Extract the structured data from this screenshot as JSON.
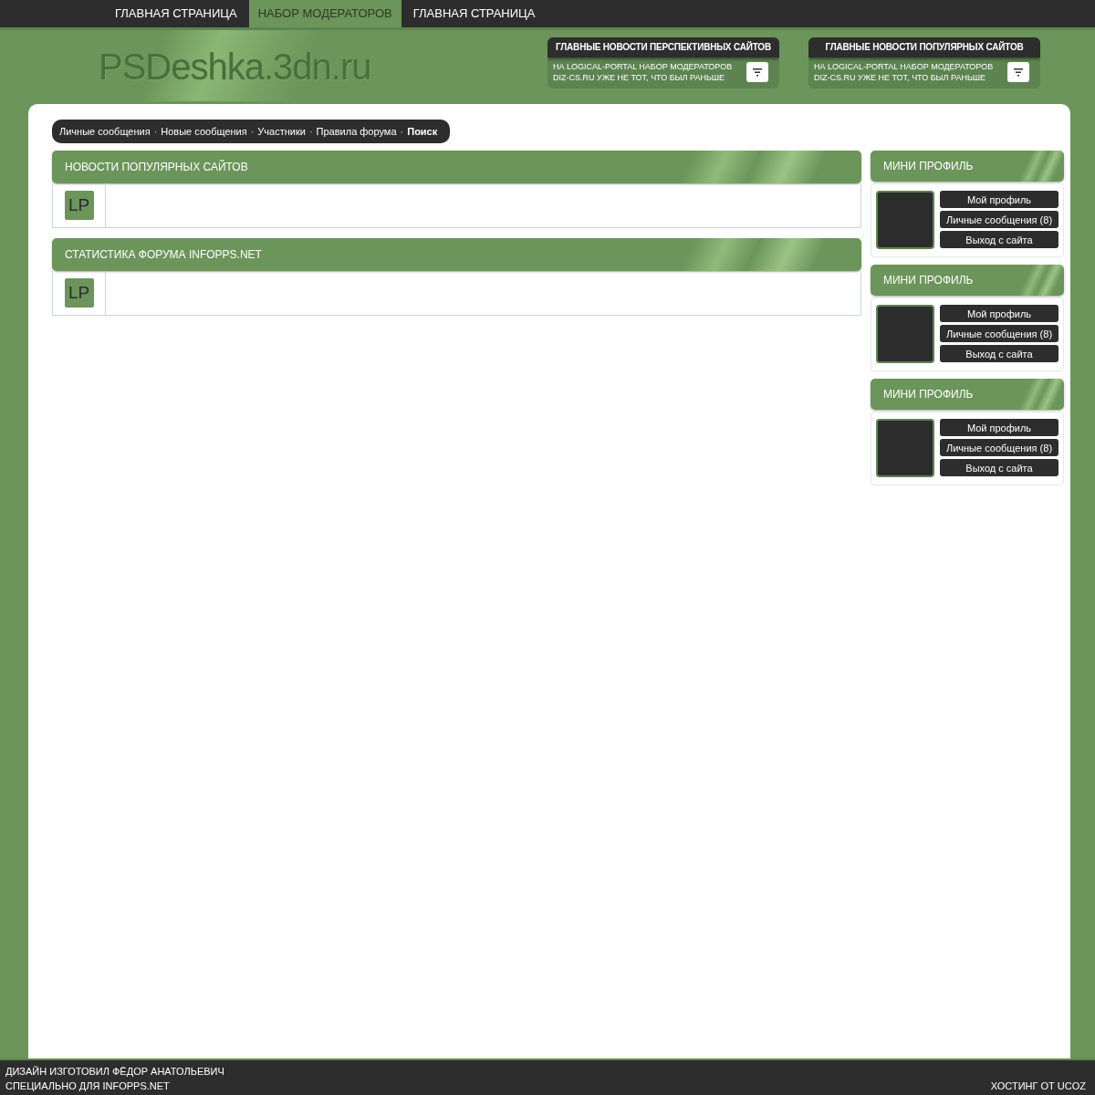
{
  "nav": [
    {
      "label": "ГЛАВНАЯ СТРАНИЦА",
      "selected": false
    },
    {
      "label": "НАБОР МОДЕРАТОРОВ",
      "selected": true
    },
    {
      "label": "ГЛАВНАЯ СТРАНИЦА",
      "selected": false
    }
  ],
  "logo": "PSDeshka.3dn.ru",
  "news_boxes": [
    {
      "title": "ГЛАВНЫЕ НОВОСТИ ПЕРСПЕКТИВНЫХ САЙТОВ",
      "lines": [
        "НА LOGICAL-PORTAL НАБОР МОДЕРАТОРОВ",
        "DIZ-CS.RU УЖЕ НЕ ТОТ, ЧТО БЫЛ РАНЬШЕ"
      ]
    },
    {
      "title": "ГЛАВНЫЕ НОВОСТИ ПОПУЛЯРНЫХ САЙТОВ",
      "lines": [
        "НА LOGICAL-PORTAL НАБОР МОДЕРАТОРОВ",
        "DIZ-CS.RU УЖЕ НЕ ТОТ, ЧТО БЫЛ РАНЬШЕ"
      ]
    }
  ],
  "breadcrumb": {
    "separator": "·",
    "links": [
      {
        "label": "Личные сообщения",
        "bold": false
      },
      {
        "label": "Новые сообщения",
        "bold": false
      },
      {
        "label": "Участники",
        "bold": false
      },
      {
        "label": "Правила форума",
        "bold": false
      },
      {
        "label": "Поиск",
        "bold": true
      }
    ]
  },
  "forum_blocks": [
    {
      "title": "НОВОСТИ ПОПУЛЯРНЫХ САЙТОВ",
      "badge": "LP"
    },
    {
      "title": "СТАТИСТИКА ФОРУМА INFOPPS.NET",
      "badge": "LP"
    }
  ],
  "mini_profiles": [
    {
      "title": "МИНИ ПРОФИЛЬ",
      "buttons": [
        "Мой профиль",
        "Личные сообщения (8)",
        "Выход с сайта"
      ]
    },
    {
      "title": "МИНИ ПРОФИЛЬ",
      "buttons": [
        "Мой профиль",
        "Личные сообщения (8)",
        "Выход с сайта"
      ]
    },
    {
      "title": "МИНИ ПРОФИЛЬ",
      "buttons": [
        "Мой профиль",
        "Личные сообщения (8)",
        "Выход с сайта"
      ]
    }
  ],
  "footer": {
    "left_lines": [
      "ДИЗАЙН ИЗГОТОВИЛ ФЁДОР АНАТОЛЬЕВИЧ",
      "СПЕЦИАЛЬНО ДЛЯ INFOPPS.NET"
    ],
    "right": "ХОСТИНГ ОТ UCOZ"
  }
}
